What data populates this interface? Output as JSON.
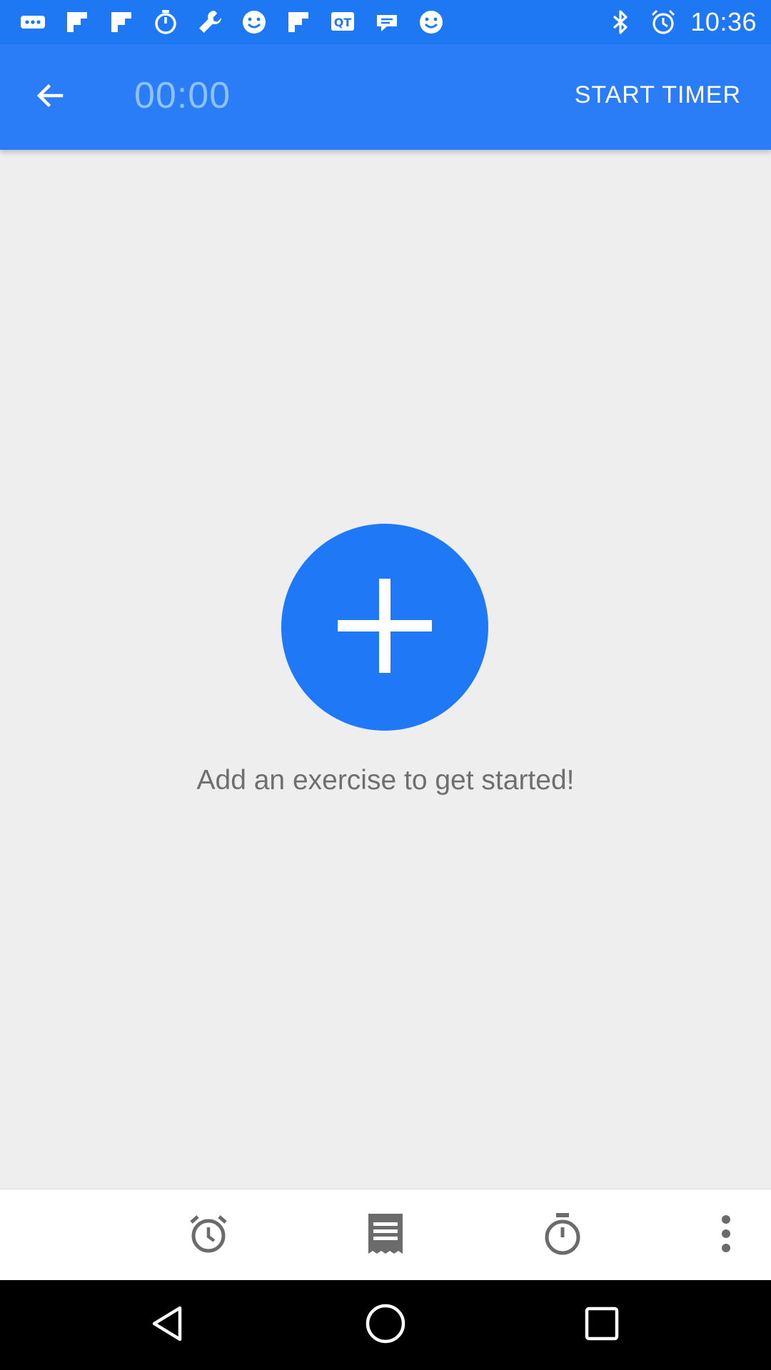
{
  "status_bar": {
    "time": "10:36",
    "left_icons": [
      "more-horiz-icon",
      "flipboard-icon",
      "flipboard-icon",
      "timer-icon",
      "wrench-icon",
      "smiley-icon",
      "flipboard-icon",
      "qr-icon",
      "chat-app-icon",
      "smiley-icon"
    ],
    "right_icons": [
      "bluetooth-icon",
      "alarm-icon"
    ]
  },
  "app_bar": {
    "timer": "00:00",
    "start_timer_label": "START TIMER",
    "back_icon": "arrow-back-icon"
  },
  "main": {
    "add_icon": "add-icon",
    "empty_message": "Add an exercise to get started!"
  },
  "bottom_bar": {
    "icons": [
      "alarm-clock-icon",
      "notes-icon",
      "stopwatch-icon",
      "more-vert-icon"
    ]
  },
  "nav_bar": {
    "icons": [
      "back-triangle-icon",
      "home-circle-icon",
      "recents-square-icon"
    ]
  },
  "colors": {
    "status_bar": "#1e78f3",
    "app_bar": "#2a7df6",
    "accent": "#1f78f5",
    "timer_text": "#8cc2ff",
    "background": "#eeeeee",
    "message_text": "#6f6f6f"
  }
}
